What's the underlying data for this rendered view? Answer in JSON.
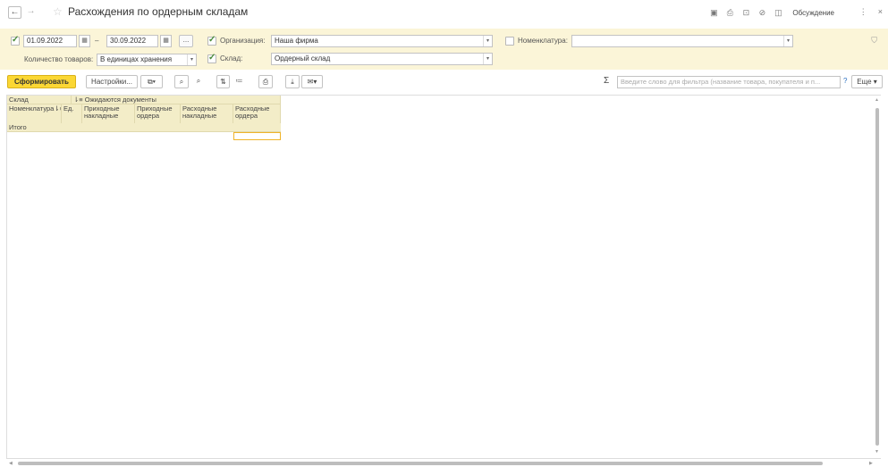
{
  "window": {
    "title": "Расхождения по ордерным складам",
    "discussion_label": "Обсуждение"
  },
  "settings": {
    "date_from": "01.09.2022",
    "date_to": "30.09.2022",
    "date_separator": "–",
    "organization_label": "Организация:",
    "organization_value": "Наша фирма",
    "nomenclature_label": "Номенклатура:",
    "nomenclature_value": "",
    "quantity_label": "Количество товаров:",
    "quantity_value": "В единицах хранения",
    "warehouse_label": "Склад:",
    "warehouse_value": "Ордерный склад",
    "dots_label": "..."
  },
  "toolbar": {
    "generate_label": "Сформировать",
    "settings_label": "Настройки...",
    "search_placeholder": "Введите слово для фильтра (название товара, покупателя и п...",
    "help_label": "?",
    "more_label": "Еще"
  },
  "report": {
    "header_row1_col1": "Склад",
    "header_row1_col2": "Ожидаются документы",
    "columns": [
      "Номенклатура",
      "Ед.",
      "Приходные накладные",
      "Приходные ордера",
      "Расходные накладные",
      "Расходные ордера"
    ],
    "total_label": "Итого"
  },
  "colors": {
    "accent_yellow": "#fbd734",
    "panel_bg": "#fbf5d8",
    "header_bg": "#f3edc8",
    "selection": "#f0b429"
  }
}
